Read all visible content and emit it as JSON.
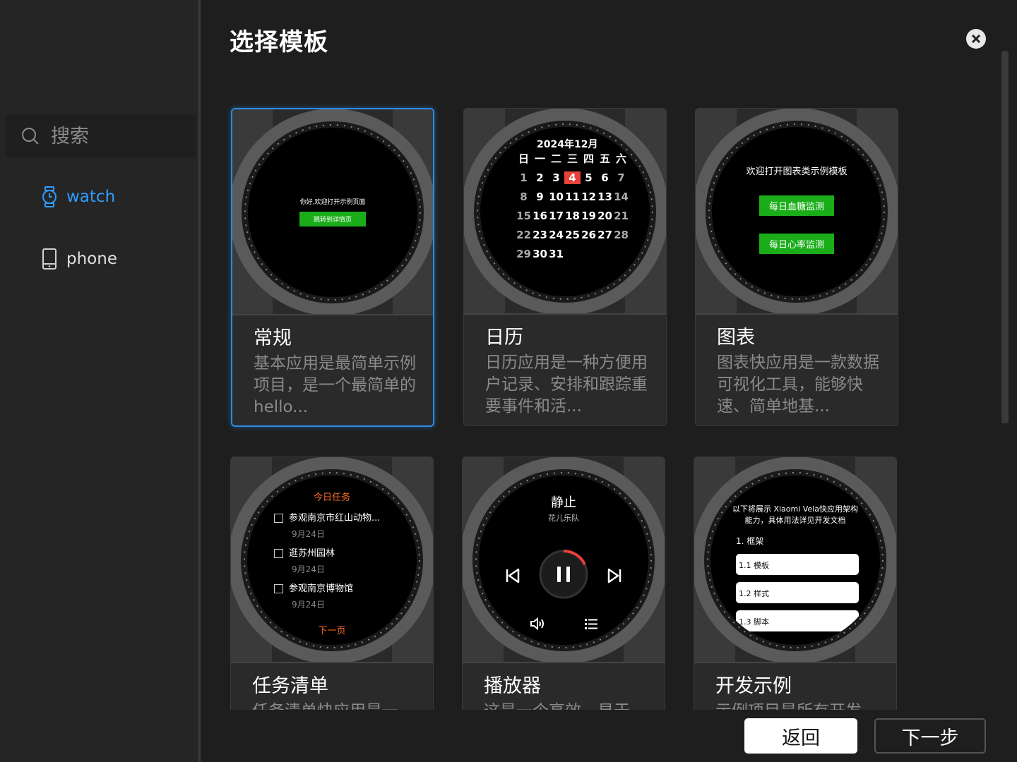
{
  "sidebar": {
    "search_placeholder": "搜索",
    "items": [
      {
        "label": "watch",
        "icon": "watch-icon",
        "active": true
      },
      {
        "label": "phone",
        "icon": "phone-icon",
        "active": false
      }
    ]
  },
  "dialog": {
    "title": "选择模板"
  },
  "templates": [
    {
      "title": "常规",
      "desc": "基本应用是最简单示例项目，是一个最简单的hello...",
      "selected": true,
      "preview": {
        "text": "你好,欢迎打开示例页面",
        "button": "跳转到详情页"
      }
    },
    {
      "title": "日历",
      "desc": "日历应用是一种方便用户记录、安排和跟踪重要事件和活...",
      "selected": false,
      "preview": {
        "month": "2024年12月",
        "weekdays": [
          "日",
          "一",
          "二",
          "三",
          "四",
          "五",
          "六"
        ],
        "weeks": [
          [
            "1",
            "2",
            "3",
            "4",
            "5",
            "6",
            "7"
          ],
          [
            "8",
            "9",
            "10",
            "11",
            "12",
            "13",
            "14"
          ],
          [
            "15",
            "16",
            "17",
            "18",
            "19",
            "20",
            "21"
          ],
          [
            "22",
            "23",
            "24",
            "25",
            "26",
            "27",
            "28"
          ],
          [
            "29",
            "30",
            "31"
          ]
        ],
        "today": "4"
      }
    },
    {
      "title": "图表",
      "desc": "图表快应用是一款数据可视化工具，能够快速、简单地基...",
      "selected": false,
      "preview": {
        "text": "欢迎打开图表类示例模板",
        "buttons": [
          "每日血糖监测",
          "每日心率监测"
        ]
      }
    },
    {
      "title": "任务清单",
      "desc": "任务清单快应用是一",
      "selected": false,
      "preview": {
        "heading": "今日任务",
        "tasks": [
          {
            "name": "参观南京市红山动物...",
            "date": "9月24日"
          },
          {
            "name": "逛苏州园林",
            "date": "9月24日"
          },
          {
            "name": "参观南京博物馆",
            "date": "9月24日"
          }
        ],
        "next": "下一页"
      }
    },
    {
      "title": "播放器",
      "desc": "这是一个高效、易于",
      "selected": false,
      "preview": {
        "song": "静止",
        "artist": "花儿乐队"
      }
    },
    {
      "title": "开发示例",
      "desc": "示例项目是所有开发",
      "selected": false,
      "preview": {
        "text": "以下将展示 Xiaomi Vela快应用架构能力，具体用法详见开发文档",
        "section": "1. 框架",
        "items": [
          "1.1 模板",
          "1.2 样式",
          "1.3 脚本"
        ]
      }
    }
  ],
  "footer": {
    "back_label": "返回",
    "next_label": "下一步"
  },
  "colors": {
    "accent": "#2b8ce6",
    "green_button": "#1aad19",
    "calendar_today": "#e8413a",
    "task_heading": "#ff6a2a"
  }
}
